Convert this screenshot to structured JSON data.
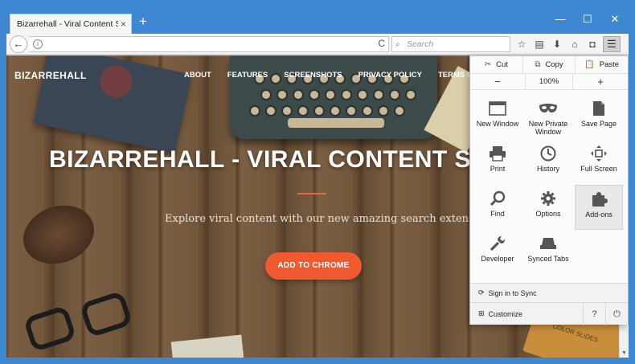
{
  "browser": {
    "tab_title": "Bizarrehall - Viral Content Search",
    "tab_close": "×",
    "new_tab": "+",
    "window_controls": {
      "minimize": "—",
      "maximize": "☐",
      "close": "✕"
    },
    "back": "←",
    "info": "i",
    "reload": "C",
    "search_placeholder": "Search",
    "search_glass": "⌕",
    "toolbar_icons": {
      "bookmark": "☆",
      "reader": "▤",
      "downloads": "⬇",
      "home": "⌂",
      "pocket": "◘"
    },
    "menu": "☰"
  },
  "site": {
    "logo": "BIZARREHALL",
    "nav": [
      "ABOUT",
      "FEATURES",
      "SCREENSHOTS",
      "PRIVACY POLICY",
      "TERMS OF SERVICE"
    ],
    "hero_title": "BIZARREHALL - VIRAL CONTENT SEARCH",
    "hero_subtitle": "Explore viral content with our new amazing search extension.",
    "cta": "ADD TO CHROME",
    "box_label": "COLOR SLIDES"
  },
  "scroll": {
    "up": "▲",
    "down": "▼"
  },
  "menu_panel": {
    "edit": [
      {
        "label": "Cut",
        "icon": "✂"
      },
      {
        "label": "Copy",
        "icon": "⧉"
      },
      {
        "label": "Paste",
        "icon": "📋"
      }
    ],
    "zoom_out": "−",
    "zoom_level": "100%",
    "zoom_in": "+",
    "items": [
      {
        "label": "New Window",
        "icon": "new-window-icon"
      },
      {
        "label": "New Private Window",
        "icon": "private-mask-icon"
      },
      {
        "label": "Save Page",
        "icon": "save-page-icon"
      },
      {
        "label": "Print",
        "icon": "print-icon"
      },
      {
        "label": "History",
        "icon": "history-clock-icon"
      },
      {
        "label": "Full Screen",
        "icon": "full-screen-icon"
      },
      {
        "label": "Find",
        "icon": "find-magnifier-icon"
      },
      {
        "label": "Options",
        "icon": "options-gear-icon"
      },
      {
        "label": "Add-ons",
        "icon": "addons-puzzle-icon"
      },
      {
        "label": "Developer",
        "icon": "developer-wrench-icon"
      },
      {
        "label": "Synced Tabs",
        "icon": "synced-tabs-icon"
      }
    ],
    "sync": "Sign in to Sync",
    "sync_icon": "⟳",
    "customize": "Customize",
    "customize_icon": "⊞",
    "help": "?",
    "quit": "⏻"
  }
}
